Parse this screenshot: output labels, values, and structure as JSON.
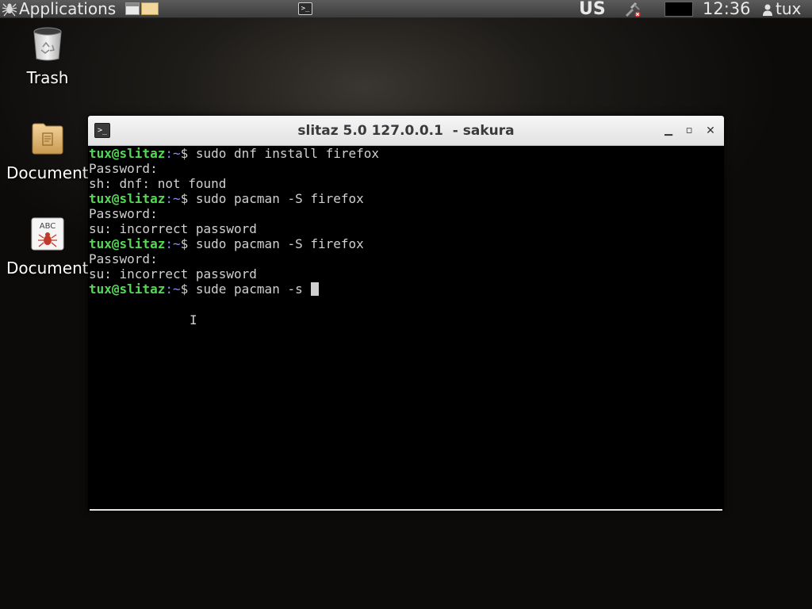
{
  "top_panel": {
    "applications_label": "Applications",
    "keyboard_layout": "US",
    "clock": "12:36",
    "username": "tux"
  },
  "desktop_icons": [
    {
      "label": "Trash"
    },
    {
      "label": "Documents"
    },
    {
      "label": "Documentation"
    }
  ],
  "terminal": {
    "title": "slitaz 5.0 127.0.0.1  - sakura",
    "prompt_user": "tux@slitaz",
    "prompt_path": ":~",
    "prompt_sign": "$ ",
    "lines": [
      {
        "type": "prompt",
        "command": "sudo dnf install firefox"
      },
      {
        "type": "output",
        "text": "Password:"
      },
      {
        "type": "output",
        "text": "sh: dnf: not found"
      },
      {
        "type": "prompt",
        "command": "sudo pacman -S firefox"
      },
      {
        "type": "output",
        "text": "Password:"
      },
      {
        "type": "output",
        "text": "su: incorrect password"
      },
      {
        "type": "prompt",
        "command": "sudo pacman -S firefox"
      },
      {
        "type": "output",
        "text": "Password:"
      },
      {
        "type": "output",
        "text": "su: incorrect password"
      },
      {
        "type": "prompt",
        "command": "sude pacman -s ",
        "active": true
      }
    ]
  },
  "colors": {
    "prompt_user": "#55d855",
    "prompt_path": "#8a8aff",
    "terminal_text": "#d0d0d0",
    "terminal_bg": "#000000",
    "titlebar_bg": "#eeeeee"
  },
  "icons": {
    "applications": "spider-icon",
    "workspace": "workspace-switcher-icon",
    "task": "terminal-icon",
    "network": "network-disconnected-icon",
    "user": "user-icon",
    "trash": "trash-icon",
    "documents": "folder-icon",
    "documentation": "documentation-icon"
  }
}
